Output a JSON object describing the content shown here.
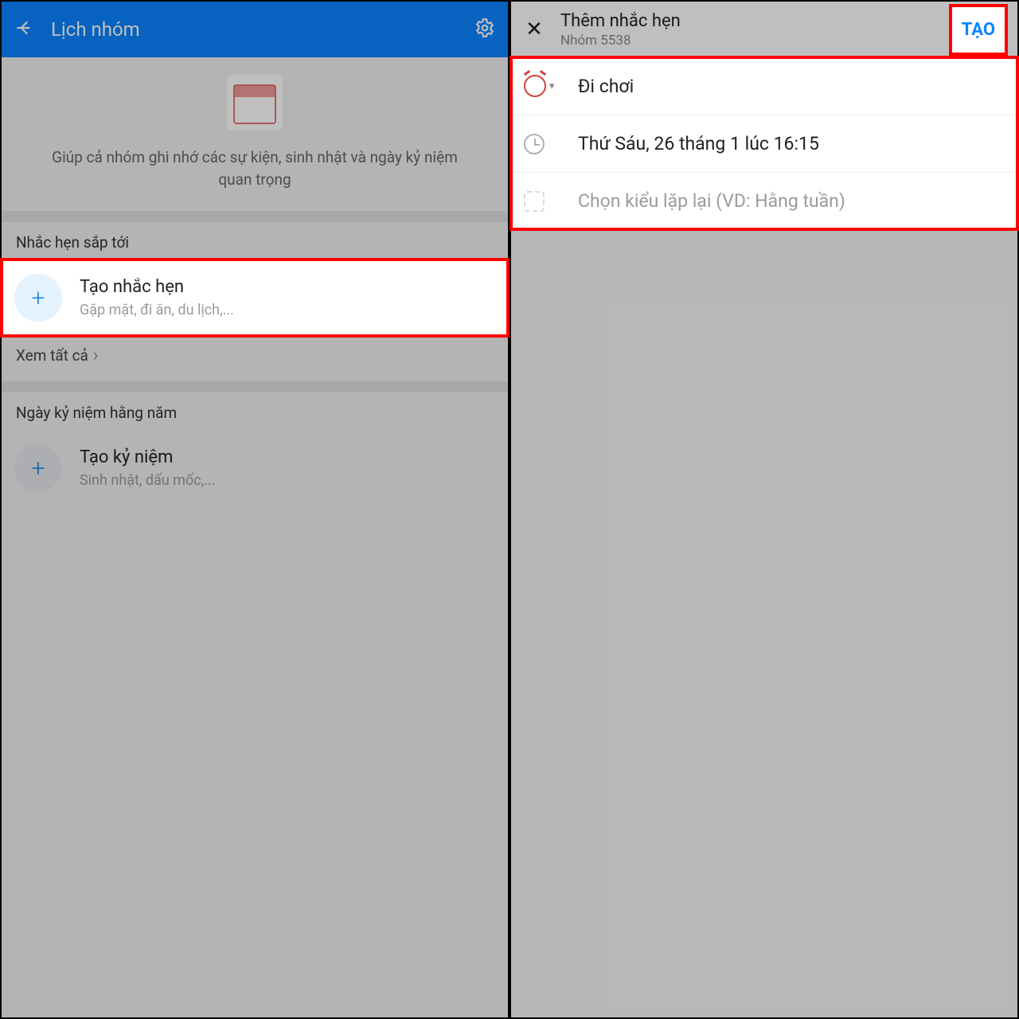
{
  "left": {
    "header_title": "Lịch nhóm",
    "intro_text": "Giúp cả nhóm ghi nhớ các sự kiện, sinh nhật và ngày kỷ niệm quan trọng",
    "sections": {
      "upcoming_label": "Nhắc hẹn sắp tới",
      "create_reminder": {
        "title": "Tạo nhắc hẹn",
        "sub": "Gặp mặt, đi ăn, du lịch,..."
      },
      "view_all": "Xem tất cả",
      "anniversary_label": "Ngày kỷ niệm hằng năm",
      "create_anniv": {
        "title": "Tạo kỷ niệm",
        "sub": "Sinh nhật, dấu mốc,..."
      }
    }
  },
  "right": {
    "header": {
      "title": "Thêm nhắc hẹn",
      "subtitle": "Nhóm 5538",
      "create_label": "TẠO"
    },
    "form": {
      "name": "Đi chơi",
      "datetime": "Thứ Sáu, 26 tháng 1 lúc 16:15",
      "repeat_placeholder": "Chọn kiểu lặp lại (VD: Hằng tuần)"
    }
  }
}
